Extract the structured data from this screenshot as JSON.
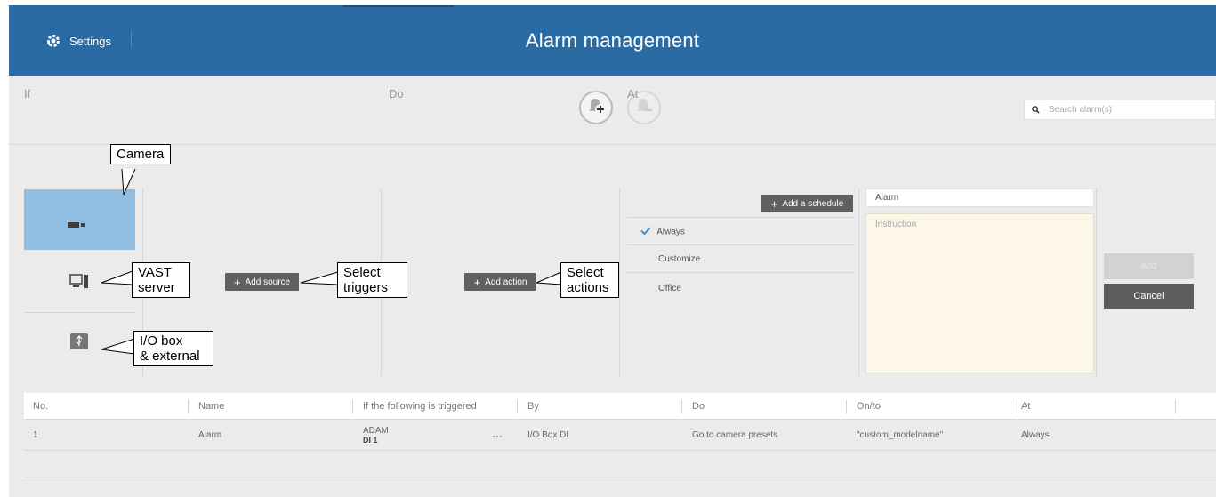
{
  "header": {
    "settings_label": "Settings",
    "title": "Alarm management"
  },
  "toolbar": {
    "search_placeholder": "Search alarm(s)"
  },
  "columns": {
    "if_label": "If",
    "do_label": "Do",
    "at_label": "At"
  },
  "buttons": {
    "add_source": "Add source",
    "add_action": "Add action",
    "add_schedule": "Add a schedule",
    "add": "Add",
    "cancel": "Cancel"
  },
  "schedules": [
    {
      "label": "Always",
      "checked": true
    },
    {
      "label": "Customize",
      "checked": false
    },
    {
      "label": "Office",
      "checked": false
    }
  ],
  "alarm_form": {
    "name_value": "Alarm",
    "instruction_placeholder": "Instruction"
  },
  "table": {
    "headers": [
      "No.",
      "Name",
      "If the following is triggered",
      "By",
      "Do",
      "On/to",
      "At"
    ],
    "rows": [
      {
        "no": "1",
        "name": "Alarm",
        "trigger_main": "ADAM",
        "trigger_sub": "DI 1",
        "more": "···",
        "by": "I/O Box DI",
        "do": "Go to camera presets",
        "on_to": "\"custom_modelname\"",
        "at": "Always"
      }
    ]
  },
  "callouts": {
    "camera": "Camera",
    "vast_server": "VAST\nserver",
    "io_box": "I/O box\n& external",
    "select_triggers": "Select\ntriggers",
    "select_actions": "Select\nactions"
  },
  "icons": {
    "settings": "gear-icon",
    "add_alarm": "bell-plus-icon",
    "remove_alarm": "bell-minus-icon",
    "search": "search-icon",
    "camera": "camera-icon",
    "server": "server-icon",
    "io_box": "usb-box-icon",
    "check": "check-icon"
  },
  "colors": {
    "topbar": "#2b6ba3",
    "selected_tile": "#91bde0",
    "check": "#3a8fd6"
  }
}
